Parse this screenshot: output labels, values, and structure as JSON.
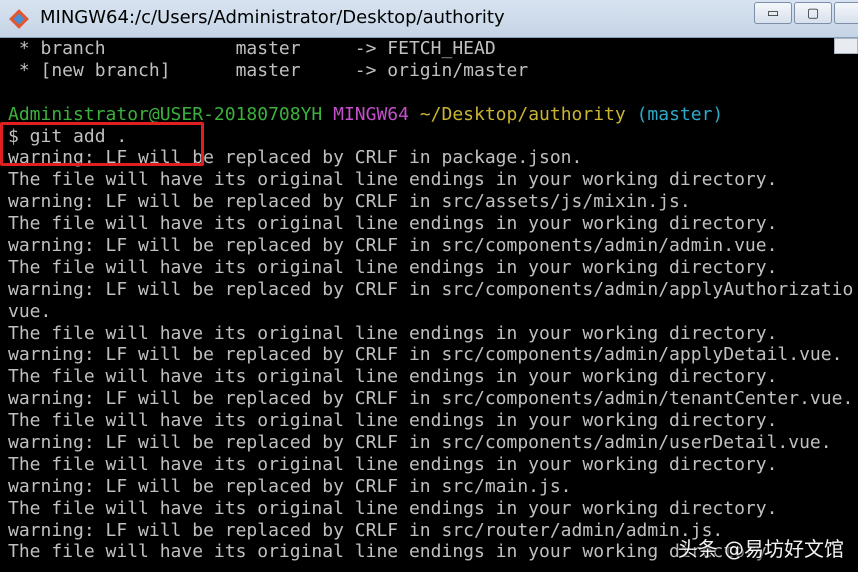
{
  "window": {
    "title": "MINGW64:/c/Users/Administrator/Desktop/authority",
    "minimize_glyph": "▭",
    "maximize_glyph": "▢"
  },
  "terminal": {
    "lines": [
      {
        "text": " * branch            master     -> FETCH_HEAD"
      },
      {
        "text": " * [new branch]      master     -> origin/master"
      },
      {
        "text": ""
      },
      {
        "prompt": true,
        "user": "Administrator@USER-20180708YH",
        "shell": "MINGW64",
        "path": "~/Desktop/authority",
        "branch": "(master)"
      },
      {
        "text": "$ git add ."
      },
      {
        "text": "warning: LF will be replaced by CRLF in package.json."
      },
      {
        "text": "The file will have its original line endings in your working directory."
      },
      {
        "text": "warning: LF will be replaced by CRLF in src/assets/js/mixin.js."
      },
      {
        "text": "The file will have its original line endings in your working directory."
      },
      {
        "text": "warning: LF will be replaced by CRLF in src/components/admin/admin.vue."
      },
      {
        "text": "The file will have its original line endings in your working directory."
      },
      {
        "text": "warning: LF will be replaced by CRLF in src/components/admin/applyAuthorizatio"
      },
      {
        "text": "vue."
      },
      {
        "text": "The file will have its original line endings in your working directory."
      },
      {
        "text": "warning: LF will be replaced by CRLF in src/components/admin/applyDetail.vue."
      },
      {
        "text": "The file will have its original line endings in your working directory."
      },
      {
        "text": "warning: LF will be replaced by CRLF in src/components/admin/tenantCenter.vue."
      },
      {
        "text": "The file will have its original line endings in your working directory."
      },
      {
        "text": "warning: LF will be replaced by CRLF in src/components/admin/userDetail.vue."
      },
      {
        "text": "The file will have its original line endings in your working directory."
      },
      {
        "text": "warning: LF will be replaced by CRLF in src/main.js."
      },
      {
        "text": "The file will have its original line endings in your working directory."
      },
      {
        "text": "warning: LF will be replaced by CRLF in src/router/admin/admin.js."
      },
      {
        "text": "The file will have its original line endings in your working directory."
      }
    ]
  },
  "watermark": "头条 @易坊好文馆",
  "colors": {
    "user": "#3bb13b",
    "shell": "#c54fcc",
    "path": "#c9b532",
    "branch": "#2ea8c8",
    "highlight": "#e02020"
  }
}
